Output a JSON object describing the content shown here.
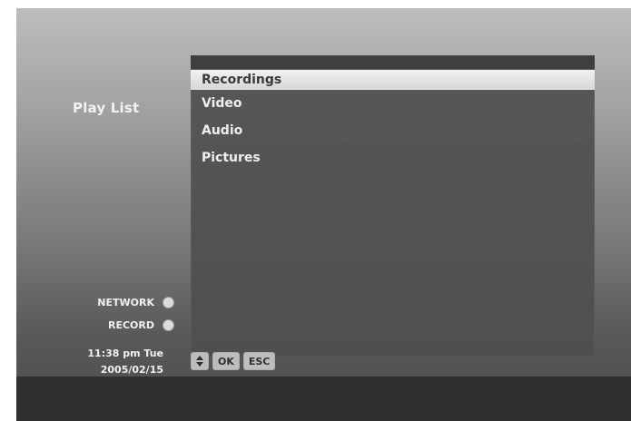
{
  "header": {
    "title": "Play List"
  },
  "menu": {
    "items": [
      {
        "label": "Recordings",
        "selected": true
      },
      {
        "label": "Video"
      },
      {
        "label": "Audio"
      },
      {
        "label": "Pictures"
      }
    ]
  },
  "status": {
    "network_label": "NETWORK",
    "record_label": "RECORD"
  },
  "clock": {
    "time": "11:38 pm Tue",
    "date": "2005/02/15"
  },
  "keys": {
    "arrow_icon": "up-down-arrows-icon",
    "ok_label": "OK",
    "esc_label": "ESC"
  }
}
